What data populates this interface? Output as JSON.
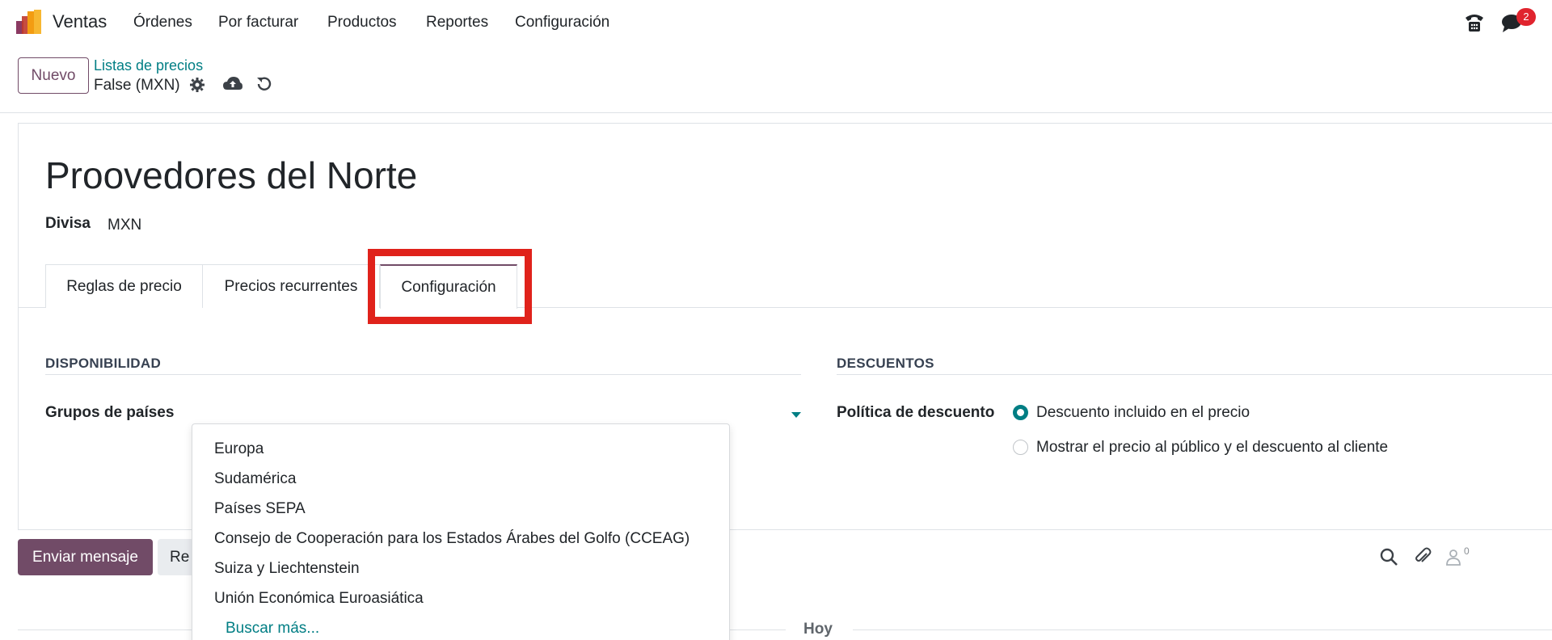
{
  "navbar": {
    "app_name": "Ventas",
    "menu": [
      "Órdenes",
      "Por facturar",
      "Productos",
      "Reportes",
      "Configuración"
    ],
    "chat_badge": "2"
  },
  "control_panel": {
    "new_button": "Nuevo",
    "breadcrumb": "Listas de precios",
    "record_name": "False (MXN)"
  },
  "form": {
    "title": "Proovedores del Norte",
    "currency_label": "Divisa",
    "currency_value": "MXN",
    "tabs": [
      "Reglas de precio",
      "Precios recurrentes",
      "Configuración"
    ],
    "active_tab": "Configuración",
    "availability": {
      "section_title": "DISPONIBILIDAD",
      "country_groups_label": "Grupos de países"
    },
    "discounts": {
      "section_title": "DESCUENTOS",
      "policy_label": "Política de descuento",
      "options": [
        "Descuento incluido en el precio",
        "Mostrar el precio al público y el descuento al cliente"
      ],
      "selected": "Descuento incluido en el precio"
    }
  },
  "dropdown": {
    "items": [
      "Europa",
      "Sudamérica",
      "Países SEPA",
      "Consejo de Cooperación para los Estados Árabes del Golfo (CCEAG)",
      "Suiza y Liechtenstein",
      "Unión Económica Euroasiática"
    ],
    "search_more": "Buscar más..."
  },
  "chatter": {
    "send_message": "Enviar mensaje",
    "log_note_partial": "Re",
    "follower_count": "0",
    "date_separator": "Hoy"
  },
  "colors": {
    "brand": "#714b67",
    "accent": "#017e84",
    "highlight": "#e0221b"
  }
}
